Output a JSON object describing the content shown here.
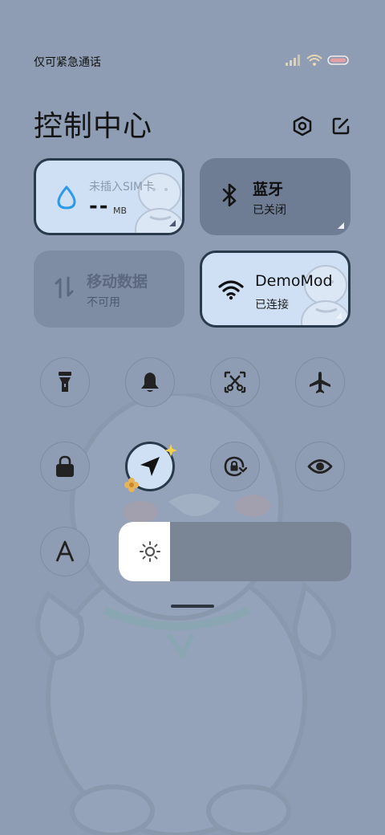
{
  "status_bar": {
    "carrier_text": "仅可紧急通话"
  },
  "header": {
    "title": "控制中心",
    "settings_icon": "settings-hexagon-icon",
    "edit_icon": "edit-icon"
  },
  "tiles": {
    "data_usage": {
      "label": "未插入SIM卡",
      "value": "--",
      "unit": "MB"
    },
    "bluetooth": {
      "title": "蓝牙",
      "status": "已关闭"
    },
    "mobile_data": {
      "title": "移动数据",
      "status": "不可用"
    },
    "wifi": {
      "title": "DemoMod",
      "status": "已连接"
    }
  },
  "toggles": [
    {
      "name": "flashlight",
      "icon": "flashlight-icon",
      "on": false
    },
    {
      "name": "mute",
      "icon": "bell-icon",
      "on": false
    },
    {
      "name": "screenshot",
      "icon": "screenshot-scissors-icon",
      "on": false
    },
    {
      "name": "airplane",
      "icon": "airplane-icon",
      "on": false
    },
    {
      "name": "lock",
      "icon": "lock-icon",
      "on": false
    },
    {
      "name": "location",
      "icon": "location-arrow-icon",
      "on": true
    },
    {
      "name": "auto-rotate",
      "icon": "rotate-lock-icon",
      "on": false
    },
    {
      "name": "eye-comfort",
      "icon": "eye-icon",
      "on": false
    },
    {
      "name": "font-size",
      "icon": "font-a-icon",
      "on": false
    }
  ],
  "brightness": {
    "level": 0.22,
    "icon": "sun-icon"
  },
  "colors": {
    "active_tile": "#cfe0f5",
    "inactive_tile": "#6e7d93",
    "background": "#8e9db3"
  }
}
